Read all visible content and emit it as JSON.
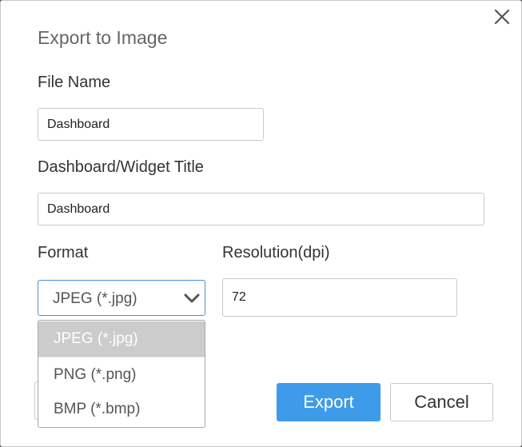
{
  "dialog": {
    "title": "Export to Image",
    "close_icon": "close-icon"
  },
  "fields": {
    "file_name": {
      "label": "File Name",
      "value": "Dashboard"
    },
    "widget_title": {
      "label": "Dashboard/Widget Title",
      "value": "Dashboard"
    },
    "format": {
      "label": "Format",
      "selected": "JPEG (*.jpg)",
      "chevron_icon": "chevron-down-icon",
      "options": [
        "JPEG (*.jpg)",
        "PNG (*.png)",
        "BMP (*.bmp)"
      ]
    },
    "resolution": {
      "label": "Resolution(dpi)",
      "value": "72"
    }
  },
  "buttons": {
    "export": "Export",
    "cancel": "Cancel"
  },
  "colors": {
    "primary": "#3d9be9",
    "focus_border": "#4a90d9",
    "selected_option_bg": "#cccccc"
  }
}
